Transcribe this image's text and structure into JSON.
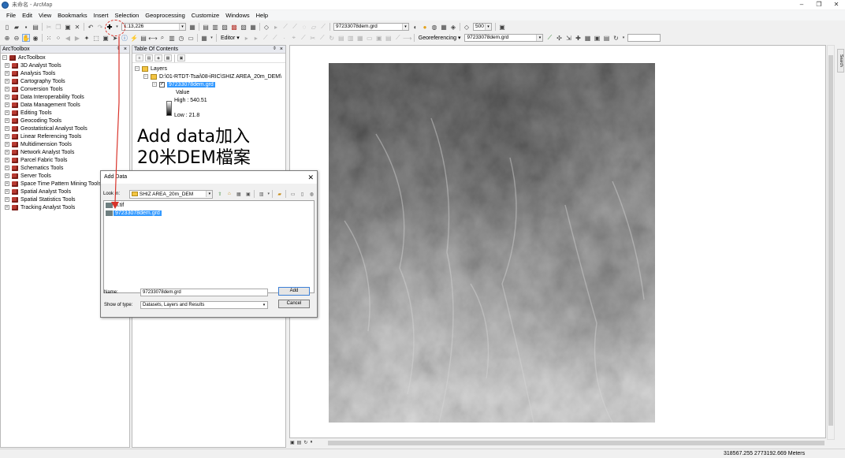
{
  "window": {
    "title": "未命名 - ArcMap",
    "controls": [
      "–",
      "❐",
      "✕"
    ]
  },
  "menubar": [
    "File",
    "Edit",
    "View",
    "Bookmarks",
    "Insert",
    "Selection",
    "Geoprocessing",
    "Customize",
    "Windows",
    "Help"
  ],
  "toolbar": {
    "scale": "1:13,226",
    "layer_combo": "97233078dem.grd",
    "value_combo": "500",
    "editor_label": "Editor ▾",
    "georef_label": "Georeferencing ▾",
    "georef_layer": "97233078dem.grd"
  },
  "toolbox": {
    "header": "ArcToolbox",
    "root": "ArcToolbox",
    "items": [
      "3D Analyst Tools",
      "Analysis Tools",
      "Cartography Tools",
      "Conversion Tools",
      "Data Interoperability Tools",
      "Data Management Tools",
      "Editing Tools",
      "Geocoding Tools",
      "Geostatistical Analyst Tools",
      "Linear Referencing Tools",
      "Multidimension Tools",
      "Network Analyst Tools",
      "Parcel Fabric Tools",
      "Schematics Tools",
      "Server Tools",
      "Space Time Pattern Mining Tools",
      "Spatial Analyst Tools",
      "Spatial Statistics Tools",
      "Tracking Analyst Tools"
    ]
  },
  "toc": {
    "header": "Table Of Contents",
    "layers_label": "Layers",
    "folder_path": "D:\\01-RTDT-Tsai\\08-iRIC\\SHIZ AREA_20m_DEM\\",
    "layer_name": "97233078dem.grd",
    "legend_title": "Value",
    "legend_high": "High : 540.51",
    "legend_low": "Low : 21.8"
  },
  "annotation": {
    "line1": "Add data加入",
    "line2": "20米DEM檔案"
  },
  "dialog": {
    "title": "Add Data",
    "look_in_label": "Look in:",
    "look_in_value": "SHIZ AREA_20m_DEM",
    "files": [
      {
        "name": "m.tif",
        "selected": false
      },
      {
        "name": "97233078dem.grd",
        "selected": true
      }
    ],
    "name_label": "Name:",
    "name_value": "97233078dem.grd",
    "type_label": "Show of type:",
    "type_value": "Datasets, Layers and Results",
    "add_label": "Add",
    "cancel_label": "Cancel"
  },
  "status": {
    "coords": "318567.255  2773192.669 Meters"
  },
  "side_tab": "Search",
  "colors": {
    "selection": "#3399ff",
    "toolbox_icon": "#b83a32",
    "annotation_arrow": "#d9342b"
  }
}
